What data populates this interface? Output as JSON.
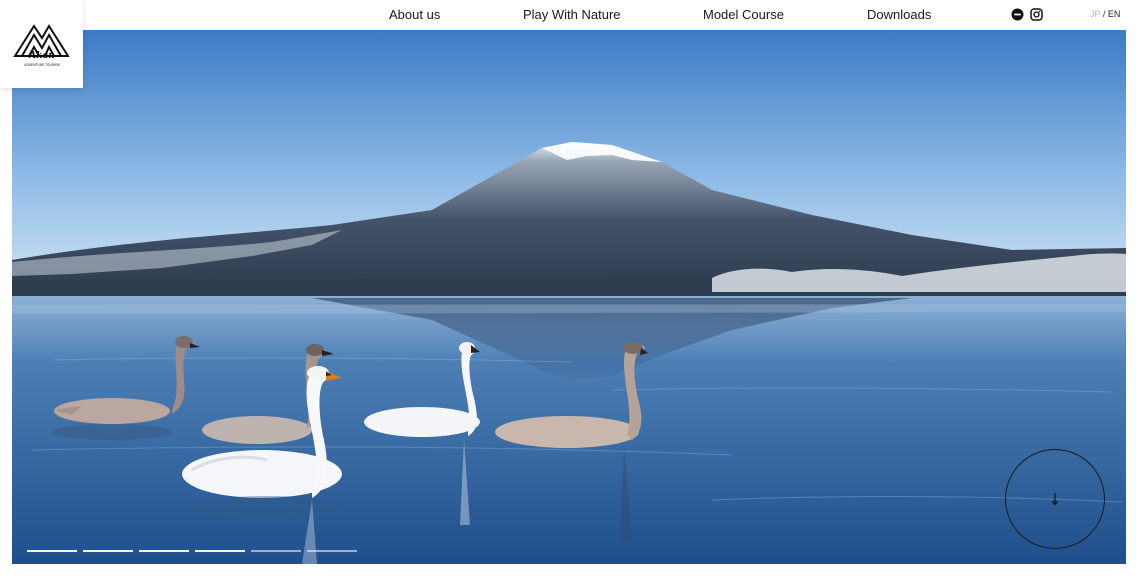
{
  "brand": {
    "logo_text": "Akan",
    "logo_subtext": "ADVENTURE TOURISM"
  },
  "nav": {
    "items": [
      {
        "label": "About us"
      },
      {
        "label": "Play With Nature"
      },
      {
        "label": "Model Course"
      },
      {
        "label": "Downloads"
      }
    ]
  },
  "social": {
    "icons": [
      "line-icon",
      "instagram-icon"
    ]
  },
  "language": {
    "jp": "JP",
    "separator": "/",
    "en": "EN",
    "active": "EN"
  },
  "hero": {
    "image": "mountain-lake-swans",
    "slides_total": 6,
    "slide_active": 1
  },
  "scroll": {
    "icon": "arrow-down-icon"
  },
  "colors": {
    "sky_top": "#3f7fc9",
    "sky_bottom": "#cfe3f3",
    "water": "#3a6ea8",
    "text": "#1a1a1a"
  }
}
